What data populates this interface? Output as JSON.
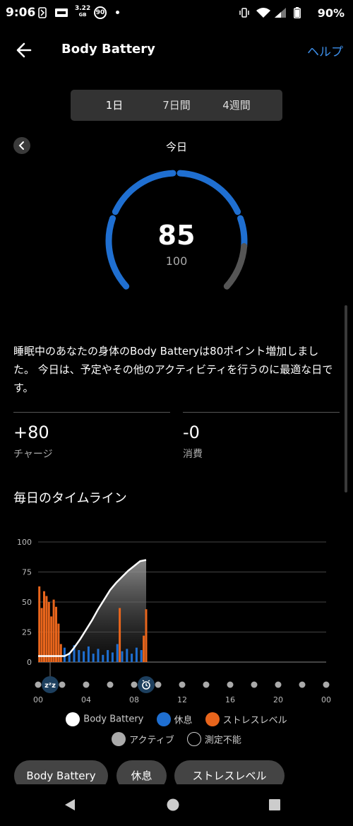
{
  "status_bar": {
    "time": "9:06",
    "data_speed": "3.22",
    "data_speed_unit": "GB",
    "badge": "90",
    "battery": "90%"
  },
  "app_bar": {
    "title": "Body Battery",
    "help": "ヘルプ",
    "back_icon": "arrow-left-icon"
  },
  "range_tabs": [
    {
      "label": "1日",
      "selected": true
    },
    {
      "label": "7日間",
      "selected": false
    },
    {
      "label": "4週間",
      "selected": false
    }
  ],
  "date_label": "今日",
  "gauge": {
    "value": "85",
    "max": "100",
    "level": 0.85,
    "color": "#1f6fd1",
    "track_color": "#555555"
  },
  "summary": "睡眠中のあなたの身体のBody Batteryは80ポイント増加しました。 今日は、予定やその他のアクティビティを行うのに最適な日です。",
  "stats": [
    {
      "value": "+80",
      "label": "チャージ"
    },
    {
      "value": "-0",
      "label": "消費"
    }
  ],
  "section_title": "毎日のタイムライン",
  "chart_data": {
    "type": "line",
    "y_ticks": [
      "100",
      "75",
      "50",
      "25",
      "0"
    ],
    "x_ticks": [
      "00",
      "04",
      "08",
      "12",
      "16",
      "20",
      "00"
    ],
    "ylim": [
      0,
      100
    ],
    "xlim": [
      0,
      24
    ],
    "grid": true,
    "series": [
      {
        "name": "Body Battery",
        "color": "#ffffff",
        "x": [
          0,
          2.2,
          2.6,
          3,
          3.5,
          4,
          4.5,
          5,
          5.5,
          6,
          6.5,
          7,
          7.5,
          8,
          8.5,
          9
        ],
        "y": [
          5,
          5,
          7,
          12,
          19,
          27,
          35,
          44,
          52,
          60,
          66,
          71,
          76,
          80,
          84,
          85
        ]
      }
    ],
    "stress_bars": {
      "name": "ストレスレベル",
      "color": "#e8651c",
      "x": [
        0.1,
        0.3,
        0.5,
        0.7,
        0.9,
        1.1,
        1.3,
        1.5,
        1.7,
        1.9,
        6.8,
        8.8,
        9.0
      ],
      "y": [
        63,
        45,
        59,
        55,
        50,
        38,
        52,
        46,
        32,
        15,
        45,
        22,
        44
      ]
    },
    "rest_bars": {
      "name": "休息",
      "color": "#1f6fd1",
      "x": [
        2.2,
        2.6,
        3.0,
        3.4,
        3.8,
        4.2,
        4.6,
        5.0,
        5.4,
        5.8,
        6.2,
        6.6,
        7.0,
        7.4,
        7.8,
        8.2,
        8.6
      ],
      "y": [
        12,
        8,
        14,
        10,
        9,
        13,
        7,
        11,
        6,
        10,
        8,
        15,
        9,
        11,
        7,
        12,
        10
      ]
    },
    "markers": [
      {
        "x": 1,
        "icon": "sleep-icon"
      },
      {
        "x": 9,
        "icon": "alarm-clock-icon"
      }
    ]
  },
  "legend": [
    {
      "label": "Body Battery",
      "color": "#ffffff",
      "style": "filled"
    },
    {
      "label": "休息",
      "color": "#1f6fd1",
      "style": "filled"
    },
    {
      "label": "ストレスレベル",
      "color": "#e8651c",
      "style": "filled"
    },
    {
      "label": "アクティブ",
      "color": "#aaaaaa",
      "style": "filled"
    },
    {
      "label": "測定不能",
      "color": "#000000",
      "style": "outline"
    }
  ],
  "chips": [
    "Body Battery",
    "休息",
    "ストレスレベル"
  ]
}
